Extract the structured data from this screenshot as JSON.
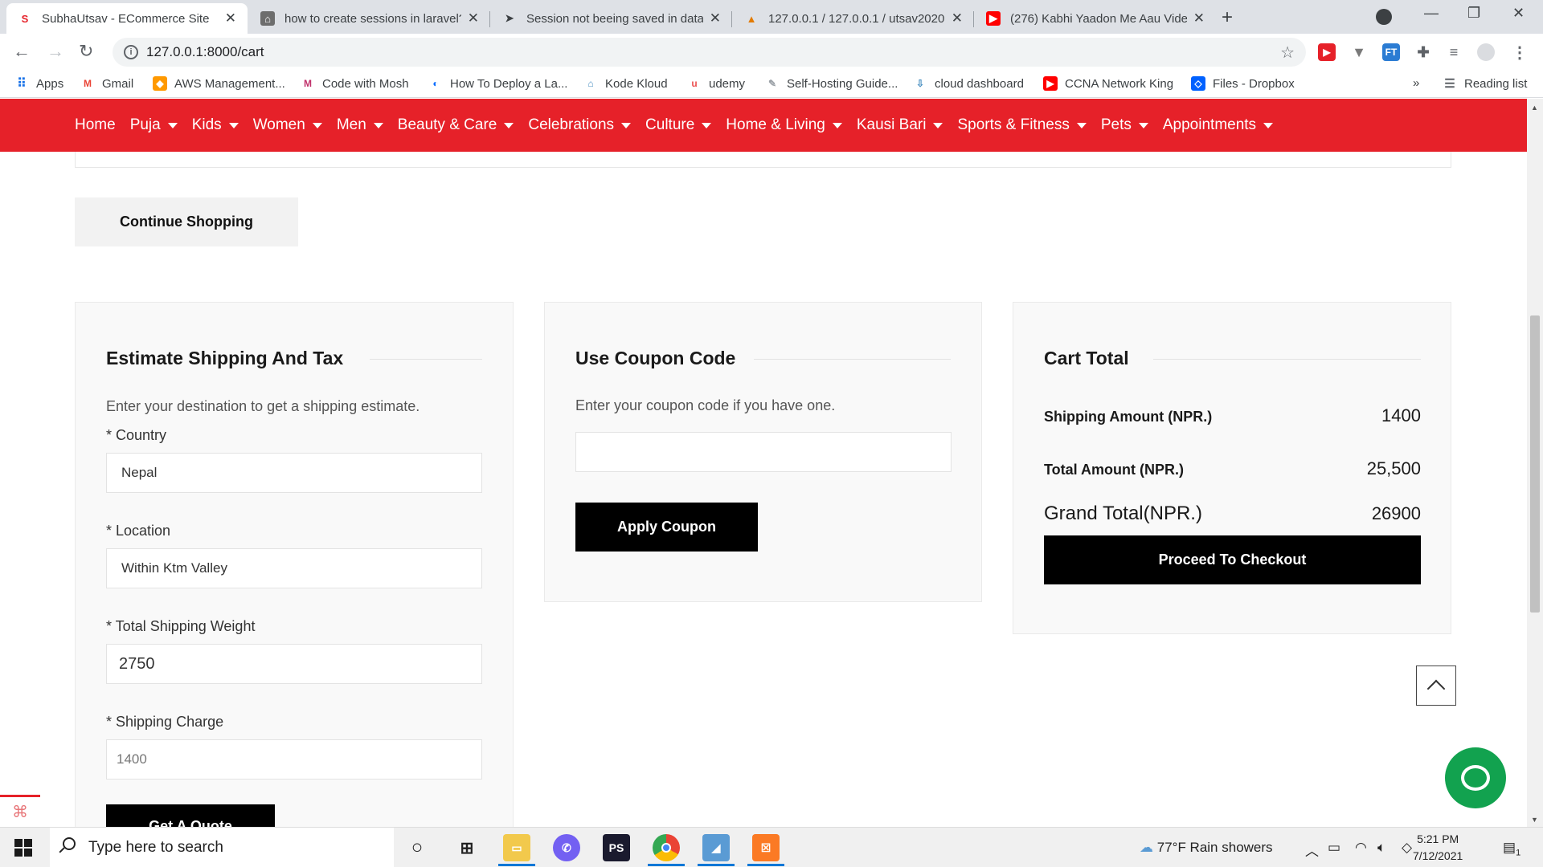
{
  "browser": {
    "tabs": [
      {
        "title": "SubhaUtsav - ECommerce Site",
        "active": true,
        "icon": "site-s-icon"
      },
      {
        "title": "how to create sessions in laravel?",
        "active": false,
        "icon": "house-icon"
      },
      {
        "title": "Session not beeing saved in data",
        "active": false,
        "icon": "paper-plane-icon"
      },
      {
        "title": "127.0.0.1 / 127.0.0.1 / utsav2020",
        "active": false,
        "icon": "pma-icon"
      },
      {
        "title": "(276) Kabhi Yaadon Me Aau Vide",
        "active": false,
        "icon": "youtube-icon"
      }
    ],
    "url": "127.0.0.1:8000/cart",
    "bookmarks": [
      "Apps",
      "Gmail",
      "AWS Management...",
      "Code with Mosh",
      "How To Deploy a La...",
      "Kode Kloud",
      "udemy",
      "Self-Hosting Guide...",
      "cloud dashboard",
      "CCNA Network King",
      "Files - Dropbox"
    ],
    "bookmarks_overflow": "»",
    "reading_list": "Reading list"
  },
  "menu": [
    {
      "label": "Home",
      "dropdown": false
    },
    {
      "label": "Puja",
      "dropdown": true
    },
    {
      "label": "Kids",
      "dropdown": true
    },
    {
      "label": "Women",
      "dropdown": true
    },
    {
      "label": "Men",
      "dropdown": true
    },
    {
      "label": "Beauty & Care",
      "dropdown": true
    },
    {
      "label": "Celebrations",
      "dropdown": true
    },
    {
      "label": "Culture",
      "dropdown": true
    },
    {
      "label": "Home & Living",
      "dropdown": true
    },
    {
      "label": "Kausi Bari",
      "dropdown": true
    },
    {
      "label": "Sports & Fitness",
      "dropdown": true
    },
    {
      "label": "Pets",
      "dropdown": true
    },
    {
      "label": "Appointments",
      "dropdown": true
    }
  ],
  "continue_shopping": "Continue Shopping",
  "shipping": {
    "title": "Estimate Shipping And Tax",
    "description": "Enter your destination to get a shipping estimate.",
    "country_label": "* Country",
    "country_value": "Nepal",
    "location_label": "* Location",
    "location_value": "Within Ktm Valley",
    "weight_label": "* Total Shipping Weight",
    "weight_value": "2750",
    "charge_label": "* Shipping Charge",
    "charge_value": "1400",
    "quote_button": "Get A Quote"
  },
  "coupon": {
    "title": "Use Coupon Code",
    "description": "Enter your coupon code if you have one.",
    "input_value": "",
    "apply_button": "Apply Coupon"
  },
  "cart_total": {
    "title": "Cart Total",
    "shipping_label": "Shipping Amount (NPR.)",
    "shipping_value": "1400",
    "total_label": "Total Amount (NPR.)",
    "total_value": "25,500",
    "grand_label": "Grand Total(NPR.)",
    "grand_value": "26900",
    "checkout_button": "Proceed To Checkout"
  },
  "taskbar": {
    "search_placeholder": "Type here to search",
    "weather": "77°F  Rain showers",
    "time": "5:21 PM",
    "date": "7/12/2021",
    "notification_count": "1"
  },
  "colors": {
    "brand_red": "#e62129",
    "chat_green": "#12a24f",
    "button_black": "#000000"
  }
}
